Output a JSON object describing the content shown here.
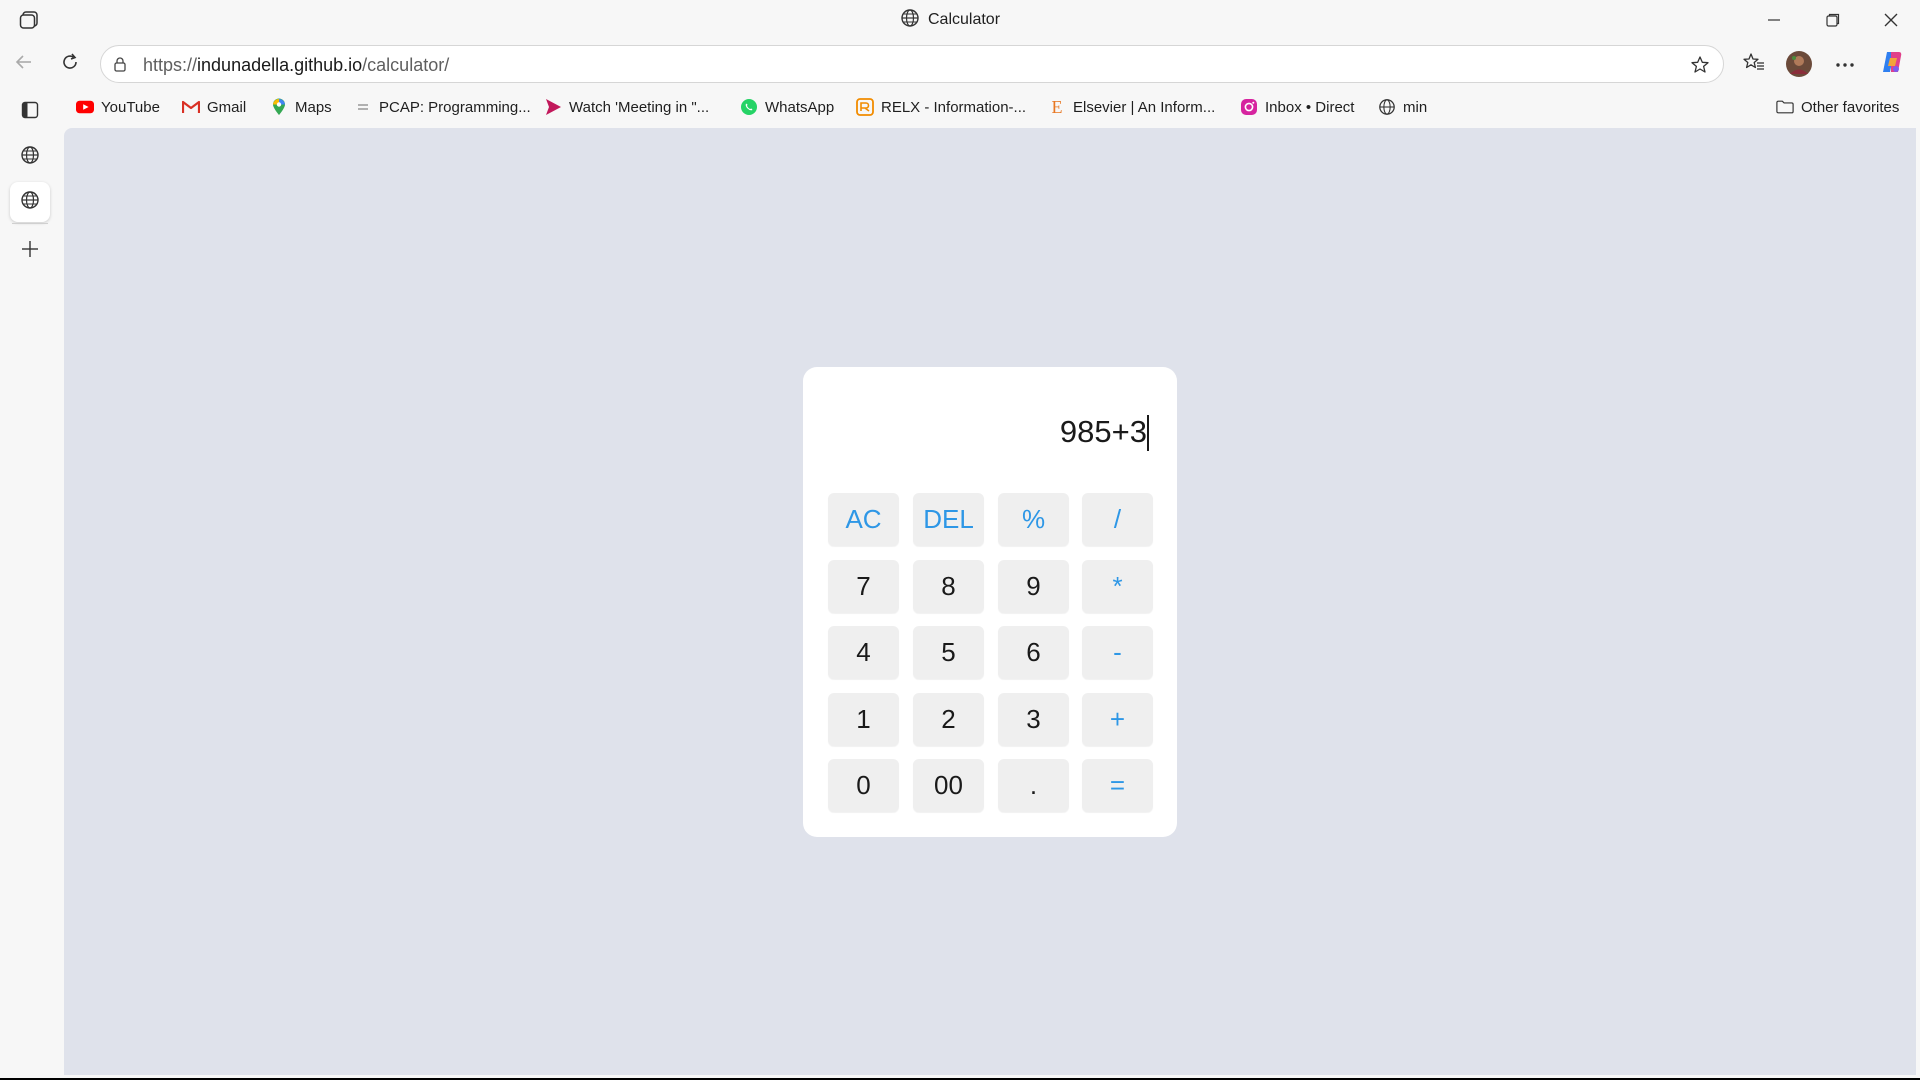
{
  "window": {
    "title": "Calculator",
    "title_icon": "globe-icon"
  },
  "address_bar": {
    "url_prefix": "https://",
    "url_domain": "indunadella.github.io",
    "url_path": "/calculator/"
  },
  "favorites": [
    {
      "label": "YouTube",
      "icon": "youtube-icon",
      "color": "#ff0000"
    },
    {
      "label": "Gmail",
      "icon": "gmail-icon",
      "color": "#d93025"
    },
    {
      "label": "Maps",
      "icon": "maps-icon",
      "color": "#34a853"
    },
    {
      "label": "PCAP: Programming...",
      "icon": "pcap-icon",
      "color": "#888888"
    },
    {
      "label": "Watch 'Meeting in \"...",
      "icon": "watch-icon",
      "color": "#c2185b"
    },
    {
      "label": "WhatsApp",
      "icon": "whatsapp-icon",
      "color": "#25d366"
    },
    {
      "label": "RELX - Information-...",
      "icon": "relx-icon",
      "color": "#f28c00"
    },
    {
      "label": "Elsevier | An Inform...",
      "icon": "elsevier-icon",
      "color": "#e87722"
    },
    {
      "label": "Inbox • Direct",
      "icon": "instagram-icon",
      "color": "#d6249f"
    },
    {
      "label": "min",
      "icon": "globe-icon",
      "color": "#333333"
    }
  ],
  "other_favorites": "Other favorites",
  "calculator": {
    "display": "985+3",
    "accent_color": "#2e97e6",
    "keys": [
      {
        "label": "AC",
        "type": "op"
      },
      {
        "label": "DEL",
        "type": "op"
      },
      {
        "label": "%",
        "type": "op"
      },
      {
        "label": "/",
        "type": "op"
      },
      {
        "label": "7",
        "type": "num"
      },
      {
        "label": "8",
        "type": "num"
      },
      {
        "label": "9",
        "type": "num"
      },
      {
        "label": "*",
        "type": "op"
      },
      {
        "label": "4",
        "type": "num"
      },
      {
        "label": "5",
        "type": "num"
      },
      {
        "label": "6",
        "type": "num"
      },
      {
        "label": "-",
        "type": "op"
      },
      {
        "label": "1",
        "type": "num"
      },
      {
        "label": "2",
        "type": "num"
      },
      {
        "label": "3",
        "type": "num"
      },
      {
        "label": "+",
        "type": "op"
      },
      {
        "label": "0",
        "type": "num"
      },
      {
        "label": "00",
        "type": "num"
      },
      {
        "label": ".",
        "type": "num"
      },
      {
        "label": "=",
        "type": "op"
      }
    ]
  }
}
